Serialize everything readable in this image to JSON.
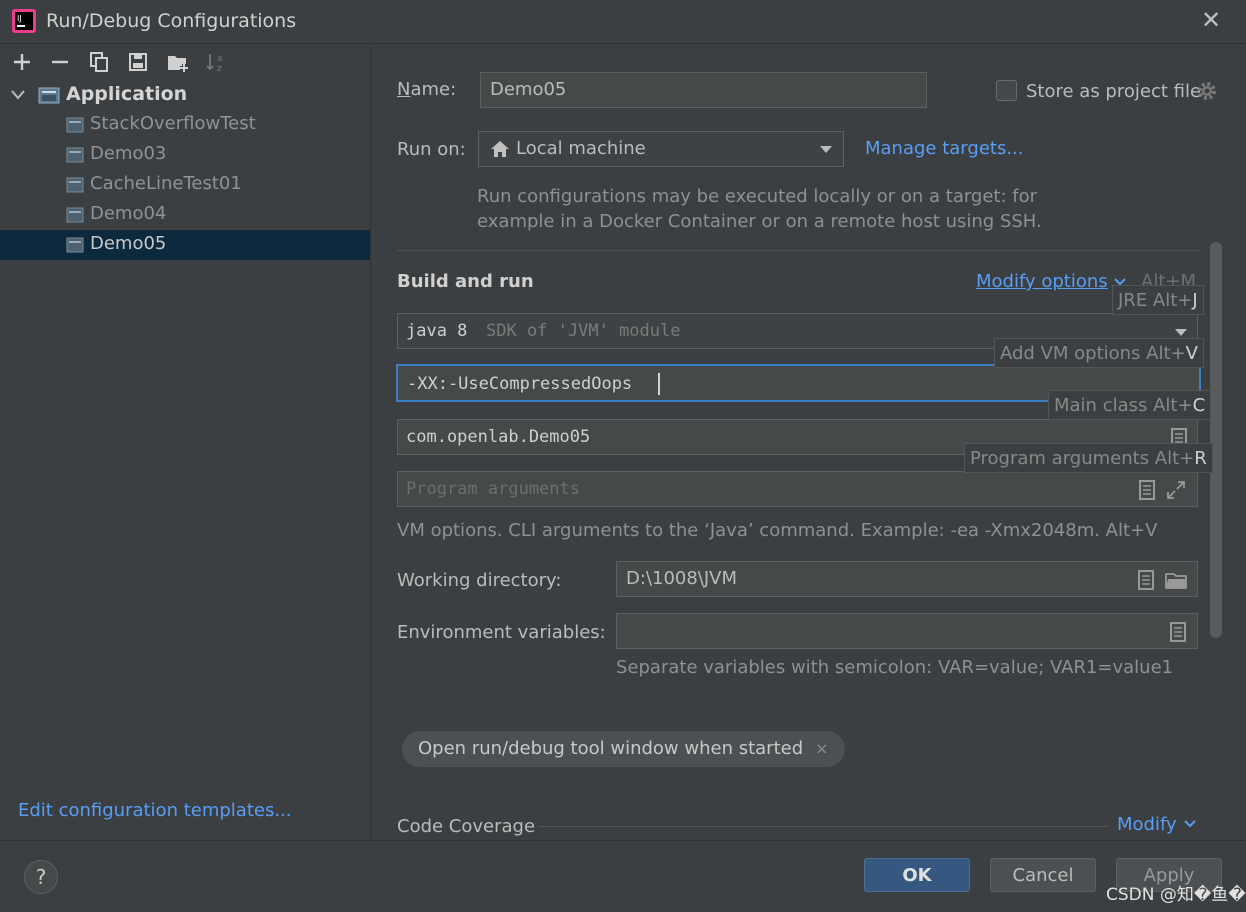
{
  "window": {
    "title": "Run/Debug Configurations",
    "close_glyph": "✕"
  },
  "toolbar": {
    "icons": [
      "add-icon",
      "remove-icon",
      "copy-icon",
      "save-icon",
      "folder-add-icon",
      "sort-icon"
    ]
  },
  "tree": {
    "group": "Application",
    "items": [
      {
        "label": "StackOverflowTest"
      },
      {
        "label": "Demo03"
      },
      {
        "label": "CacheLineTest01"
      },
      {
        "label": "Demo04"
      },
      {
        "label": "Demo05",
        "selected": true
      }
    ]
  },
  "left_footer": {
    "edit_templates": "Edit configuration templates..."
  },
  "form": {
    "name_label": "Name:",
    "name_value": "Demo05",
    "store_label": "Store as project file",
    "run_on_label": "Run on:",
    "run_on_value": "Local machine",
    "manage_targets": "Manage targets...",
    "run_on_hint_1": "Run configurations may be executed locally or on a target: for",
    "run_on_hint_2": "example in a Docker Container or on a remote host using SSH.",
    "build_run_title": "Build and run",
    "modify_options": "Modify options",
    "modify_shortcut": "Alt+M",
    "jre_value": "java 8",
    "jre_detail": "SDK of 'JVM' module",
    "vm_options_value": "-XX:-UseCompressedOops",
    "main_class_value": "com.openlab.Demo05",
    "program_args_placeholder": "Program arguments",
    "vm_hint": "VM options. CLI arguments to the ‘Java’ command. Example: -ea -Xmx2048m. Alt+V",
    "working_dir_label": "Working directory:",
    "working_dir_value": "D:\\1008\\JVM",
    "env_label": "Environment variables:",
    "env_value": "",
    "env_hint": "Separate variables with semicolon: VAR=value; VAR1=value1",
    "tag_chip": "Open run/debug tool window when started",
    "tag_close": "×",
    "coverage_title": "Code Coverage",
    "coverage_modify": "Modify"
  },
  "popups": {
    "jre": {
      "text": "JRE Alt+",
      "key": "J"
    },
    "vm": {
      "text": "Add VM options Alt+",
      "key": "V"
    },
    "main": {
      "text": "Main class Alt+",
      "key": "C"
    },
    "prog": {
      "text": "Program arguments Alt+",
      "key": "R"
    }
  },
  "buttons": {
    "help": "?",
    "ok": "OK",
    "cancel": "Cancel",
    "apply": "Apply"
  },
  "watermark": "CSDN @知�鱼�",
  "colors": {
    "accent": "#589df6",
    "selection": "#0d293e",
    "ok_button": "#365880",
    "focus_border": "#3d7fc2"
  }
}
